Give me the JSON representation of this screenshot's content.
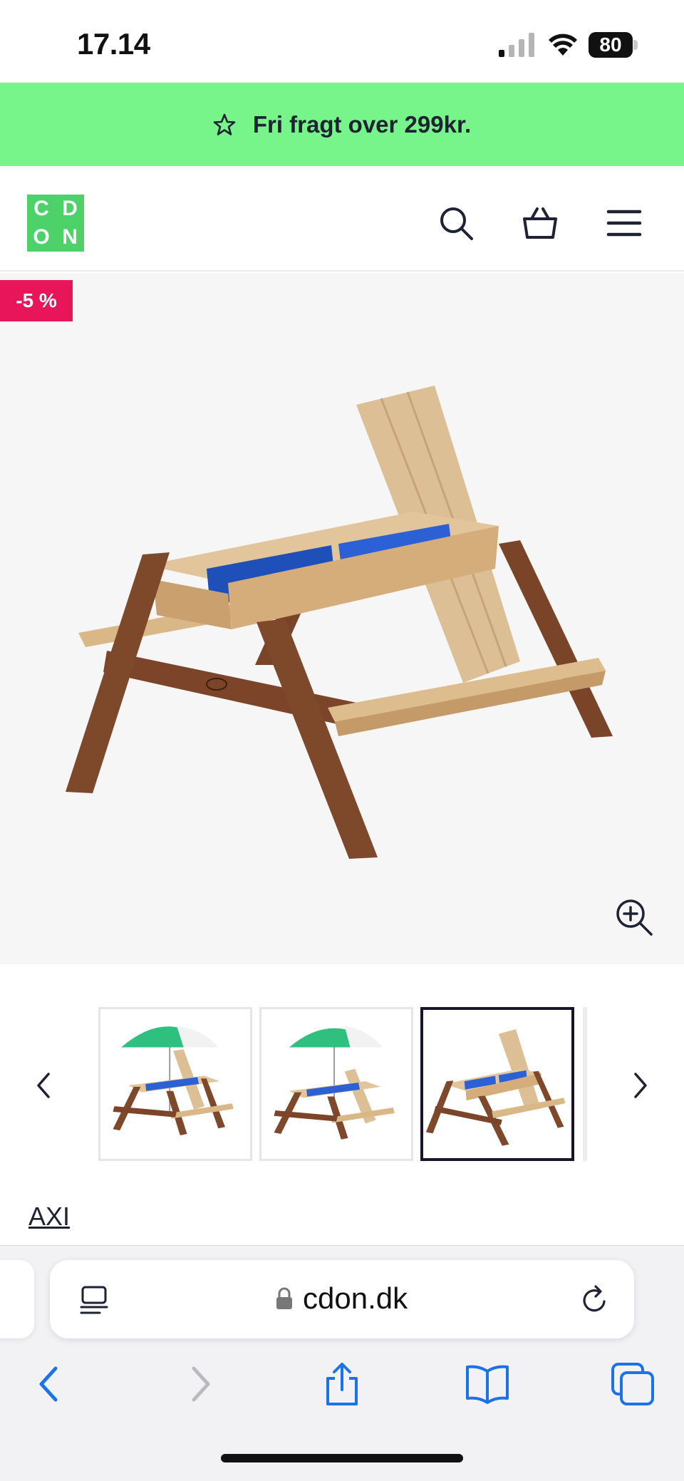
{
  "status_bar": {
    "time": "17.14",
    "battery": "80"
  },
  "promo": {
    "icon": "star-icon",
    "text": "Fri fragt over 299kr.",
    "color": "#77f58a"
  },
  "header": {
    "logo_letters": [
      "C",
      "D",
      "O",
      "N"
    ],
    "logo_color": "#4dd269",
    "icons": [
      "search-icon",
      "basket-icon",
      "menu-icon"
    ]
  },
  "product": {
    "discount_badge": "-5 %",
    "badge_color": "#e9155b",
    "zoom_icon": "zoom-in-icon",
    "thumbnails": [
      {
        "name": "thumbnail-1",
        "active": false,
        "umbrella": true
      },
      {
        "name": "thumbnail-2",
        "active": false,
        "umbrella": true
      },
      {
        "name": "thumbnail-3",
        "active": true,
        "umbrella": false
      }
    ],
    "brand": "AXI"
  },
  "browser": {
    "url": "cdon.dk",
    "accent_color": "#1a73e8",
    "toolbar": [
      "back-icon",
      "forward-icon",
      "share-icon",
      "bookmarks-icon",
      "tabs-icon"
    ]
  }
}
